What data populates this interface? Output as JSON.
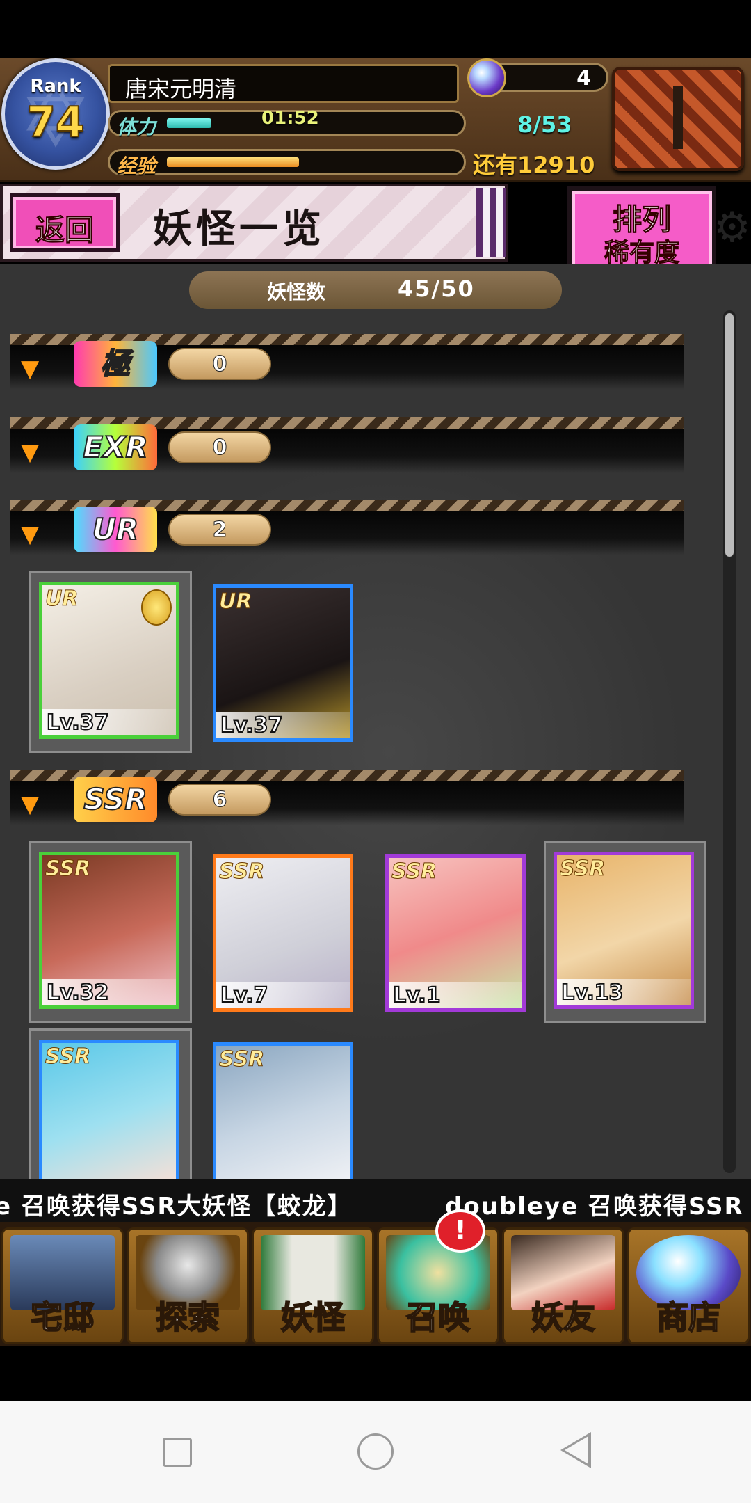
{
  "header": {
    "rank_label": "Rank",
    "rank_value": "74",
    "player_name": "唐宋元明清",
    "stamina_label": "体力",
    "stamina_timer": "01:52",
    "exp_label": "经验",
    "orb_count": "4",
    "youkai_progress": "8/53",
    "exp_remaining": "还有12910"
  },
  "title_bar": {
    "back_label": "返回",
    "page_title": "妖怪一览",
    "sort_label_top": "排列",
    "sort_label_bottom": "稀有度"
  },
  "youkai_count": {
    "label": "妖怪数",
    "value": "45/50"
  },
  "rarities": [
    {
      "tag": "極",
      "count": "0"
    },
    {
      "tag": "EXR",
      "count": "0"
    },
    {
      "tag": "UR",
      "count": "2"
    },
    {
      "tag": "SSR",
      "count": "6"
    }
  ],
  "ur_cards": [
    {
      "tag": "UR",
      "level": "Lv.37"
    },
    {
      "tag": "UR",
      "level": "Lv.37"
    }
  ],
  "ssr_cards": [
    {
      "tag": "SSR",
      "level": "Lv.32"
    },
    {
      "tag": "SSR",
      "level": "Lv.7"
    },
    {
      "tag": "SSR",
      "level": "Lv.1"
    },
    {
      "tag": "SSR",
      "level": "Lv.13"
    },
    {
      "tag": "SSR",
      "level": ""
    },
    {
      "tag": "SSR",
      "level": ""
    }
  ],
  "ticker": {
    "message_1": "e 召唤获得SSR大妖怪【蛟龙】",
    "message_2": "doubleye 召唤获得SSR"
  },
  "nav": {
    "items": [
      {
        "label": "宅邸"
      },
      {
        "label": "探索"
      },
      {
        "label": "妖怪"
      },
      {
        "label": "召唤"
      },
      {
        "label": "妖友"
      },
      {
        "label": "商店"
      }
    ],
    "summon_badge": "!"
  },
  "colors": {
    "accent_pink": "#f55cc8",
    "header_brown": "#6b4a2a",
    "stamina_teal": "#2cb9ae",
    "exp_orange": "#e88a20"
  }
}
